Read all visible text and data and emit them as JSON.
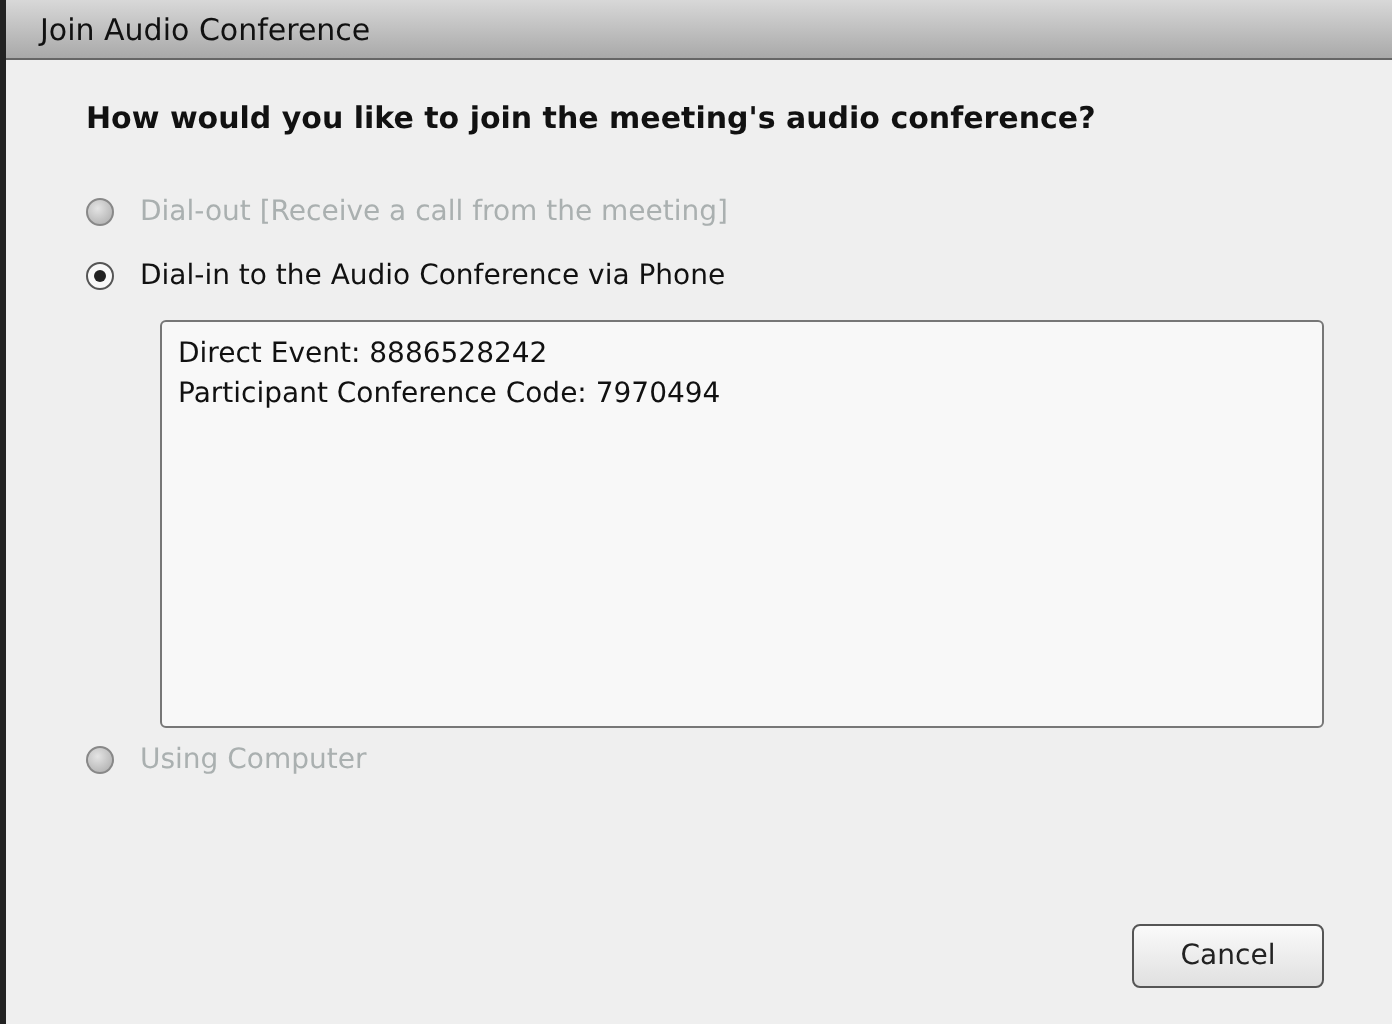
{
  "window": {
    "title": "Join Audio Conference"
  },
  "question": "How would you like to join the meeting's audio conference?",
  "options": [
    {
      "label": "Dial-out [Receive a call from the meeting]",
      "selected": false,
      "disabled": true
    },
    {
      "label": "Dial-in to the Audio Conference via Phone",
      "selected": true,
      "disabled": false,
      "details": [
        "Direct Event: 8886528242",
        "Participant Conference Code: 7970494"
      ]
    },
    {
      "label": "Using Computer",
      "selected": false,
      "disabled": true
    }
  ],
  "buttons": [
    "Cancel"
  ]
}
